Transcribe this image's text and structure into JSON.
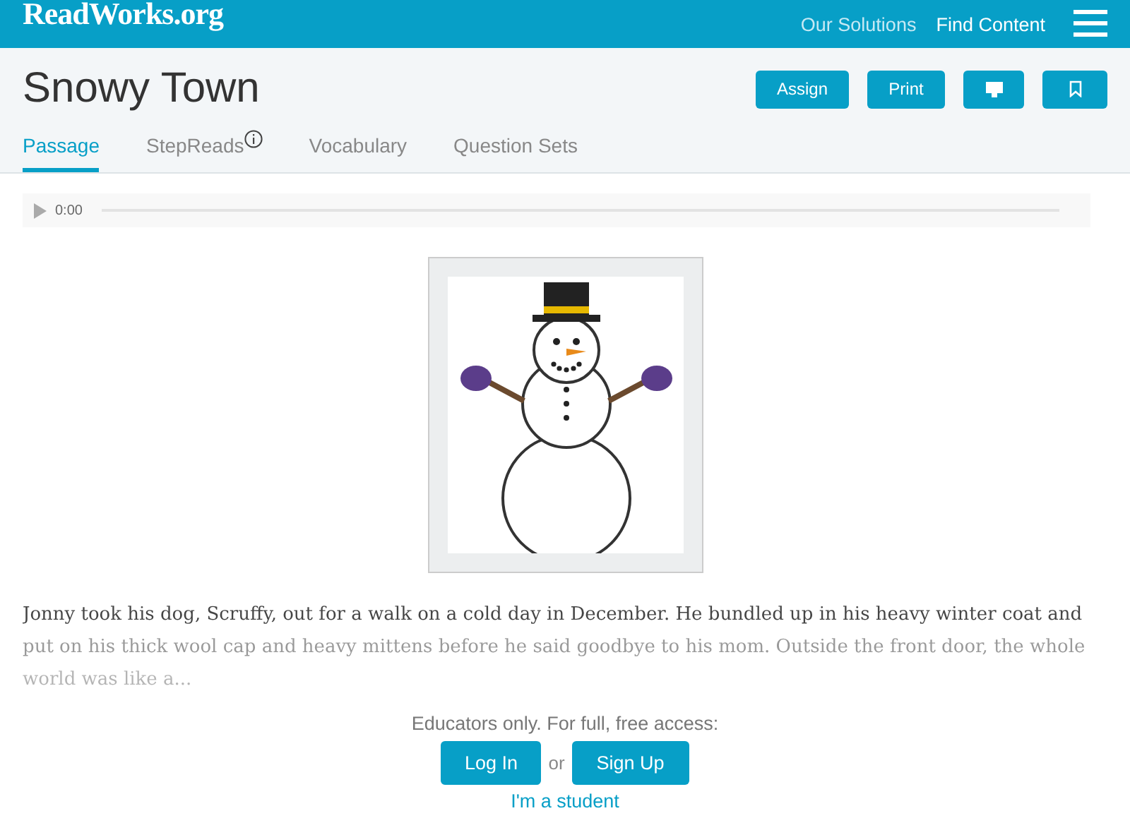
{
  "header": {
    "logo": "ReadWorks.org",
    "nav": [
      "Our Solutions",
      "Find Content"
    ]
  },
  "title": "Snowy Town",
  "actions": [
    {
      "kind": "text",
      "label": "Assign"
    },
    {
      "kind": "text",
      "label": "Print"
    },
    {
      "kind": "monitor"
    },
    {
      "kind": "bookmark"
    }
  ],
  "tabs": [
    {
      "label": "Passage",
      "selected": true,
      "info": false
    },
    {
      "label": "StepReads",
      "selected": false,
      "info": true
    },
    {
      "label": "Vocabulary",
      "selected": false,
      "info": false
    },
    {
      "label": "Question Sets",
      "selected": false,
      "info": false
    }
  ],
  "audio": {
    "time": "0:00"
  },
  "passage": "Jonny took his dog, Scruffy, out for a walk on a cold day in December. He bundled up in his heavy winter coat and put on his thick wool cap and heavy mittens before he said goodbye to his mom. Outside the front door, the whole world was like a...",
  "access": {
    "prompt": "Educators only. For full, free access:",
    "login": "Log In",
    "or": "or",
    "signup": "Sign Up",
    "student": "I'm a student"
  }
}
